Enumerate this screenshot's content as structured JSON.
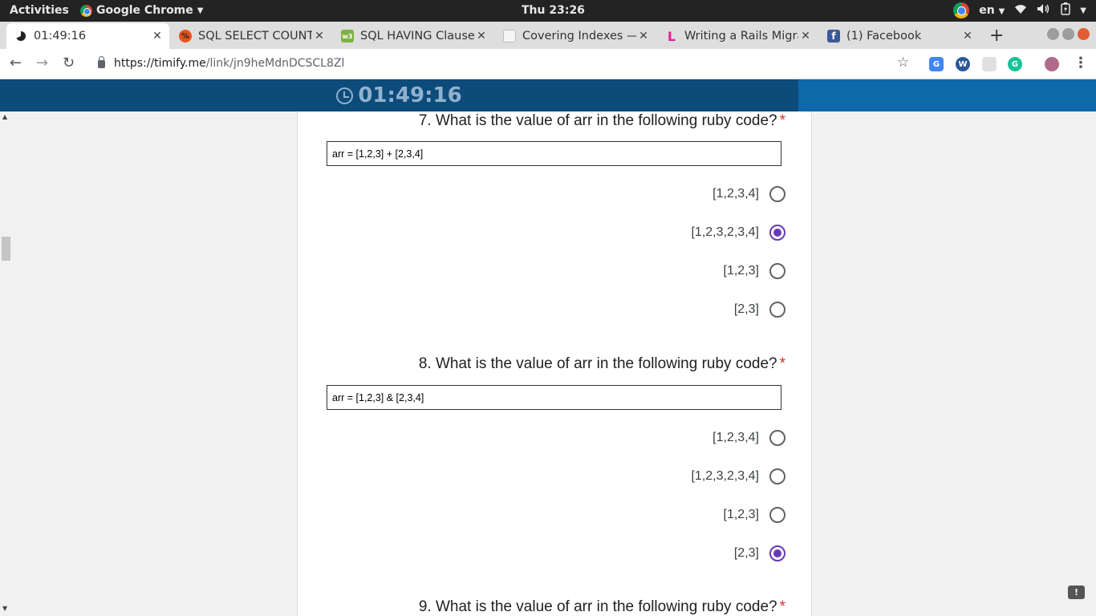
{
  "system": {
    "activities": "Activities",
    "app_name": "Google Chrome",
    "clock": "Thu 23:26",
    "language": "en"
  },
  "tabs": [
    {
      "title": "01:49:16",
      "active": true
    },
    {
      "title": "SQL SELECT COUNT,",
      "active": false
    },
    {
      "title": "SQL HAVING Clause",
      "active": false
    },
    {
      "title": "Covering Indexes — ",
      "active": false
    },
    {
      "title": "Writing a Rails Migra",
      "active": false
    },
    {
      "title": "(1) Facebook",
      "active": false
    }
  ],
  "address_bar": {
    "host": "https://timify.me",
    "path": "/link/jn9heMdnDCSCL8Zl"
  },
  "timer": {
    "value": "01:49:16"
  },
  "questions": [
    {
      "title": "7. What is the value of arr in the following ruby code?",
      "required_mark": "*",
      "code": "arr = [1,2,3] + [2,3,4]",
      "options": [
        {
          "label": "[1,2,3,4]",
          "selected": false
        },
        {
          "label": "[1,2,3,2,3,4]",
          "selected": true
        },
        {
          "label": "[1,2,3]",
          "selected": false
        },
        {
          "label": "[2,3]",
          "selected": false
        }
      ]
    },
    {
      "title": "8. What is the value of arr in the following ruby code?",
      "required_mark": "*",
      "code": "arr = [1,2,3] & [2,3,4]",
      "options": [
        {
          "label": "[1,2,3,4]",
          "selected": false
        },
        {
          "label": "[1,2,3,2,3,4]",
          "selected": false
        },
        {
          "label": "[1,2,3]",
          "selected": false
        },
        {
          "label": "[2,3]",
          "selected": true
        }
      ]
    },
    {
      "title": "9. What is the value of arr in the following ruby code?",
      "required_mark": "*"
    }
  ],
  "feedback_label": "!"
}
